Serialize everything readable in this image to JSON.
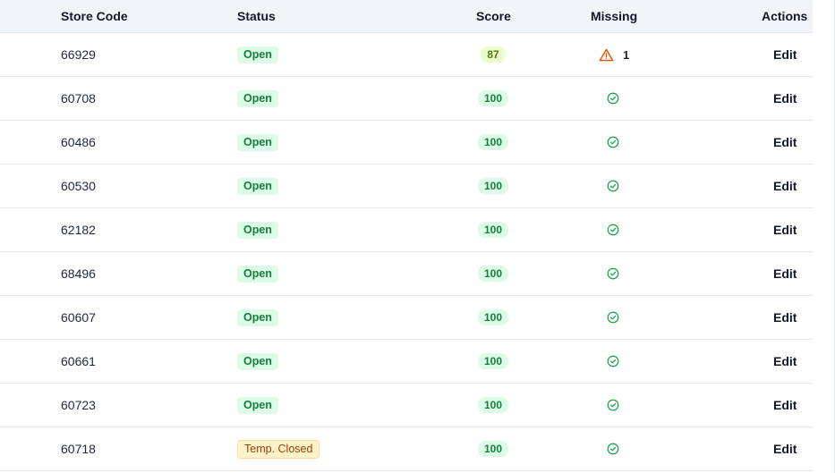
{
  "table": {
    "headers": {
      "store_code": "Store Code",
      "status": "Status",
      "score": "Score",
      "missing": "Missing",
      "actions": "Actions"
    },
    "rows": [
      {
        "store_code": "66929",
        "status": "Open",
        "status_kind": "open",
        "score": "87",
        "score_kind": "warn",
        "missing": "1",
        "missing_icon": "warning-icon",
        "action": "Edit"
      },
      {
        "store_code": "60708",
        "status": "Open",
        "status_kind": "open",
        "score": "100",
        "score_kind": "ok",
        "missing": "",
        "missing_icon": "check-circle-icon",
        "action": "Edit"
      },
      {
        "store_code": "60486",
        "status": "Open",
        "status_kind": "open",
        "score": "100",
        "score_kind": "ok",
        "missing": "",
        "missing_icon": "check-circle-icon",
        "action": "Edit"
      },
      {
        "store_code": "60530",
        "status": "Open",
        "status_kind": "open",
        "score": "100",
        "score_kind": "ok",
        "missing": "",
        "missing_icon": "check-circle-icon",
        "action": "Edit"
      },
      {
        "store_code": "62182",
        "status": "Open",
        "status_kind": "open",
        "score": "100",
        "score_kind": "ok",
        "missing": "",
        "missing_icon": "check-circle-icon",
        "action": "Edit"
      },
      {
        "store_code": "68496",
        "status": "Open",
        "status_kind": "open",
        "score": "100",
        "score_kind": "ok",
        "missing": "",
        "missing_icon": "check-circle-icon",
        "action": "Edit"
      },
      {
        "store_code": "60607",
        "status": "Open",
        "status_kind": "open",
        "score": "100",
        "score_kind": "ok",
        "missing": "",
        "missing_icon": "check-circle-icon",
        "action": "Edit"
      },
      {
        "store_code": "60661",
        "status": "Open",
        "status_kind": "open",
        "score": "100",
        "score_kind": "ok",
        "missing": "",
        "missing_icon": "check-circle-icon",
        "action": "Edit"
      },
      {
        "store_code": "60723",
        "status": "Open",
        "status_kind": "open",
        "score": "100",
        "score_kind": "ok",
        "missing": "",
        "missing_icon": "check-circle-icon",
        "action": "Edit"
      },
      {
        "store_code": "60718",
        "status": "Temp. Closed",
        "status_kind": "temp",
        "score": "100",
        "score_kind": "ok",
        "missing": "",
        "missing_icon": "check-circle-icon",
        "action": "Edit"
      }
    ]
  },
  "colors": {
    "ok_green": "#16a34a",
    "warn_orange": "#ea580c"
  }
}
